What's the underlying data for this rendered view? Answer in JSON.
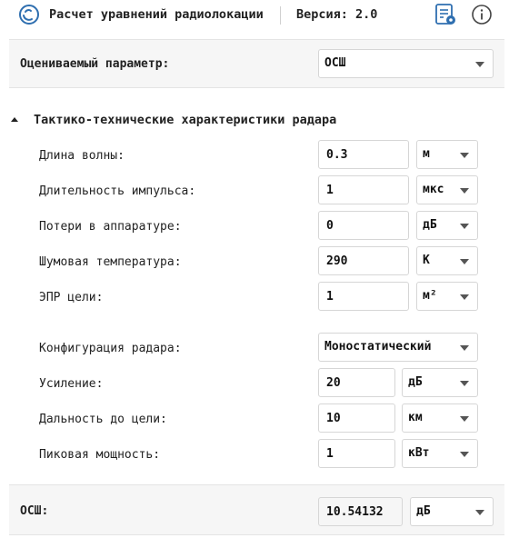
{
  "header": {
    "title": "Расчет уравнений радиолокации",
    "version_label": "Версия: 2.0",
    "icons": [
      "app-logo-icon",
      "report-settings-icon",
      "info-icon"
    ]
  },
  "estimated_param": {
    "label": "Оцениваемый параметр:",
    "value": "ОСШ"
  },
  "section": {
    "title": "Тактико-технические характеристики радара",
    "expanded": true
  },
  "rows": {
    "wavelength": {
      "label": "Длина волны:",
      "value": "0.3",
      "unit": "м"
    },
    "pulse": {
      "label": "Длительность импульса:",
      "value": "1",
      "unit": "мкс"
    },
    "losses": {
      "label": "Потери в аппаратуре:",
      "value": "0",
      "unit": "дБ"
    },
    "noise_temp": {
      "label": "Шумовая температура:",
      "value": "290",
      "unit": "К"
    },
    "rcs": {
      "label": "ЭПР цели:",
      "value": "1",
      "unit": "м²"
    },
    "config": {
      "label": "Конфигурация радара:",
      "value": "Моностатический"
    },
    "gain": {
      "label": "Усиление:",
      "value": "20",
      "unit": "дБ"
    },
    "range": {
      "label": "Дальность до цели:",
      "value": "10",
      "unit": "км"
    },
    "peak_power": {
      "label": "Пиковая мощность:",
      "value": "1",
      "unit": "кВт"
    }
  },
  "result": {
    "label": "ОСШ:",
    "value": "10.54132",
    "unit": "дБ"
  },
  "colors": {
    "panel_bg": "#f6f6f6",
    "border": "#d6d6d6",
    "text": "#222222",
    "icon_blue": "#2f6fb0"
  }
}
